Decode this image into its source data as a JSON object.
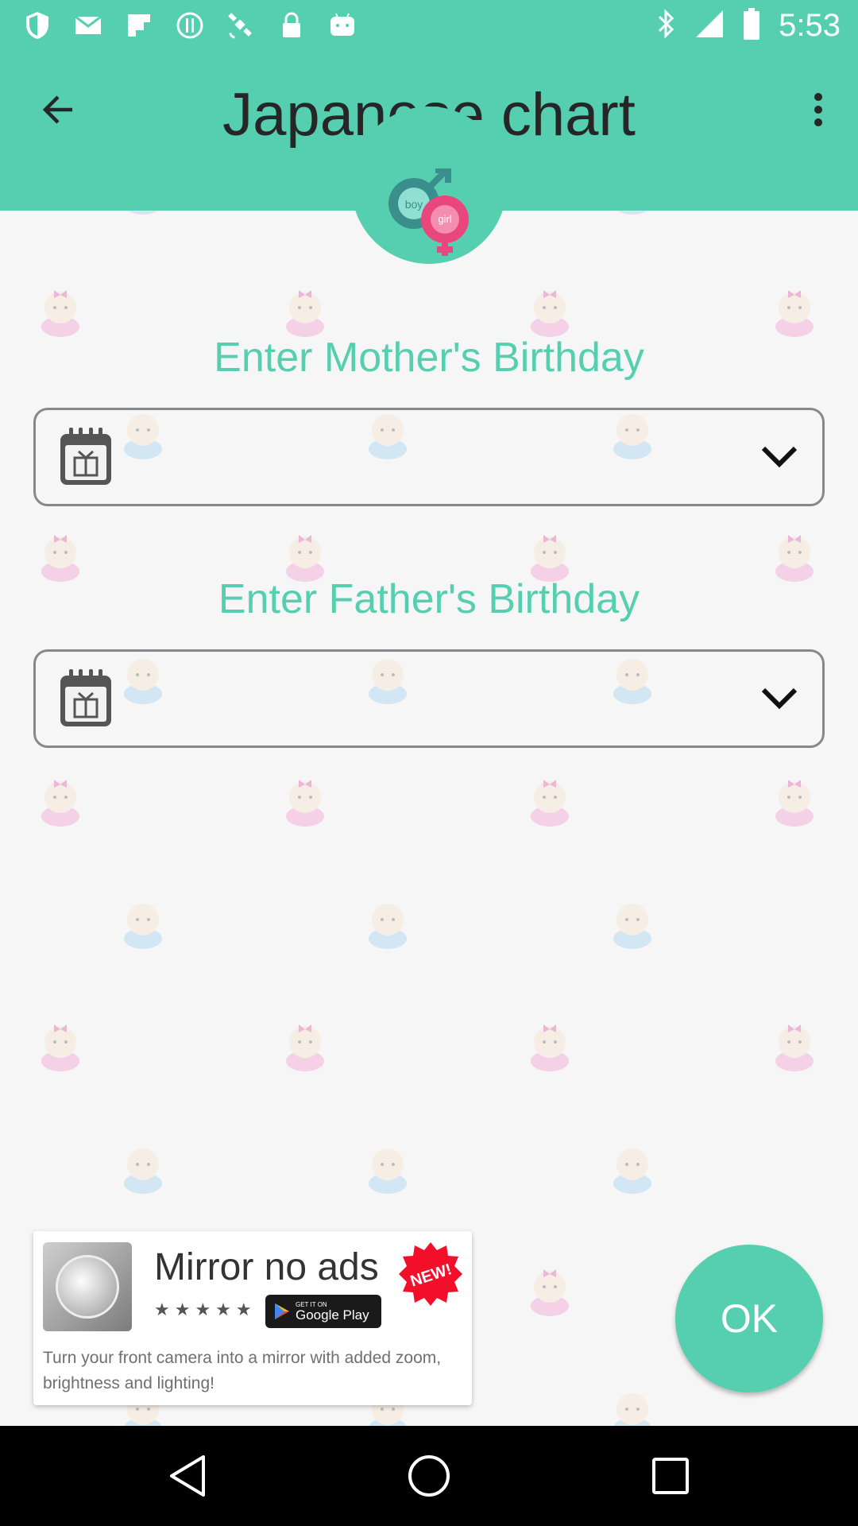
{
  "status_bar": {
    "time": "5:53",
    "left_icons": [
      "shield-icon",
      "mail-icon",
      "flipboard-icon",
      "alert-icon",
      "satellite-icon",
      "lock-icon",
      "android-icon"
    ],
    "right_icons": [
      "bluetooth-icon",
      "signal-icon",
      "battery-icon"
    ]
  },
  "app_bar": {
    "title": "Japanese chart",
    "logo_boy": "boy",
    "logo_girl": "girl"
  },
  "form": {
    "mother_label": "Enter Mother's Birthday",
    "father_label": "Enter Father's Birthday"
  },
  "ad": {
    "title": "Mirror no ads",
    "badge": "NEW!",
    "stars": "★★★★★",
    "store_small": "GET IT ON",
    "store_big": "Google Play",
    "description": "Turn your front camera into a mirror with added zoom, brightness and lighting!"
  },
  "ok_button": {
    "label": "OK"
  },
  "colors": {
    "primary": "#55cfb0",
    "title_text": "#262626",
    "girl_pink": "#e8467c"
  }
}
